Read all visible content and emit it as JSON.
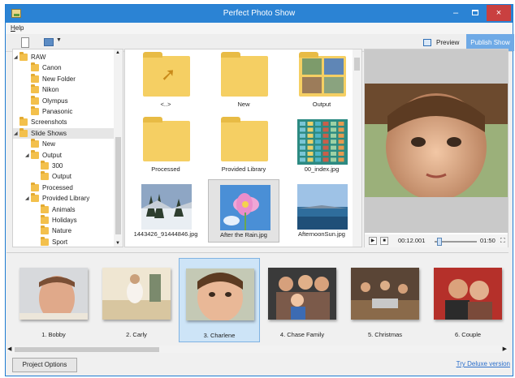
{
  "window": {
    "title": "Perfect Photo Show"
  },
  "controls": {
    "minimize": "–",
    "close": "×"
  },
  "menu": {
    "help": "Help"
  },
  "toolbar": {
    "preview_label": "Preview",
    "publish_label": "Publish Show"
  },
  "tree": {
    "items": [
      {
        "label": "RAW",
        "level": 1,
        "expanded": true
      },
      {
        "label": "Canon",
        "level": 2
      },
      {
        "label": "New Folder",
        "level": 2
      },
      {
        "label": "Nikon",
        "level": 2
      },
      {
        "label": "Olympus",
        "level": 2
      },
      {
        "label": "Panasonic",
        "level": 2
      },
      {
        "label": "Screenshots",
        "level": 1
      },
      {
        "label": "Slide Shows",
        "level": 1,
        "expanded": true,
        "selected": true
      },
      {
        "label": "New",
        "level": 2
      },
      {
        "label": "Output",
        "level": 2,
        "expanded": true
      },
      {
        "label": "300",
        "level": 3
      },
      {
        "label": "Output",
        "level": 3
      },
      {
        "label": "Processed",
        "level": 2
      },
      {
        "label": "Provided Library",
        "level": 2,
        "expanded": true
      },
      {
        "label": "Animals",
        "level": 3
      },
      {
        "label": "Holidays",
        "level": 3
      },
      {
        "label": "Nature",
        "level": 3
      },
      {
        "label": "Sport",
        "level": 3
      }
    ]
  },
  "files": {
    "items": [
      {
        "label": "<..>",
        "kind": "parent-folder"
      },
      {
        "label": "New",
        "kind": "folder"
      },
      {
        "label": "Output",
        "kind": "folder-with-photos"
      },
      {
        "label": "Processed",
        "kind": "folder"
      },
      {
        "label": "Provided Library",
        "kind": "folder"
      },
      {
        "label": "00_index.jpg",
        "kind": "image"
      },
      {
        "label": "1443426_91444846.jpg",
        "kind": "image"
      },
      {
        "label": "After the Rain.jpg",
        "kind": "image",
        "selected": true
      },
      {
        "label": "AfternoonSun.jpg",
        "kind": "image"
      }
    ]
  },
  "player": {
    "current_time": "00:12.001",
    "total_time": "01:50",
    "progress": 0.11
  },
  "slides": {
    "items": [
      {
        "label": "1. Bobby"
      },
      {
        "label": "2. Carly"
      },
      {
        "label": "3. Charlene",
        "selected": true
      },
      {
        "label": "4. Chase Family"
      },
      {
        "label": "5. Christmas"
      },
      {
        "label": "6. Couple"
      }
    ]
  },
  "footer": {
    "project_options": "Project Options",
    "deluxe_link": "Try Deluxe version"
  },
  "colors": {
    "titlebar": "#2b83d4",
    "publish": "#6faae6",
    "close": "#c94040",
    "folder": "#f5cf63",
    "link": "#2a6ecb"
  }
}
